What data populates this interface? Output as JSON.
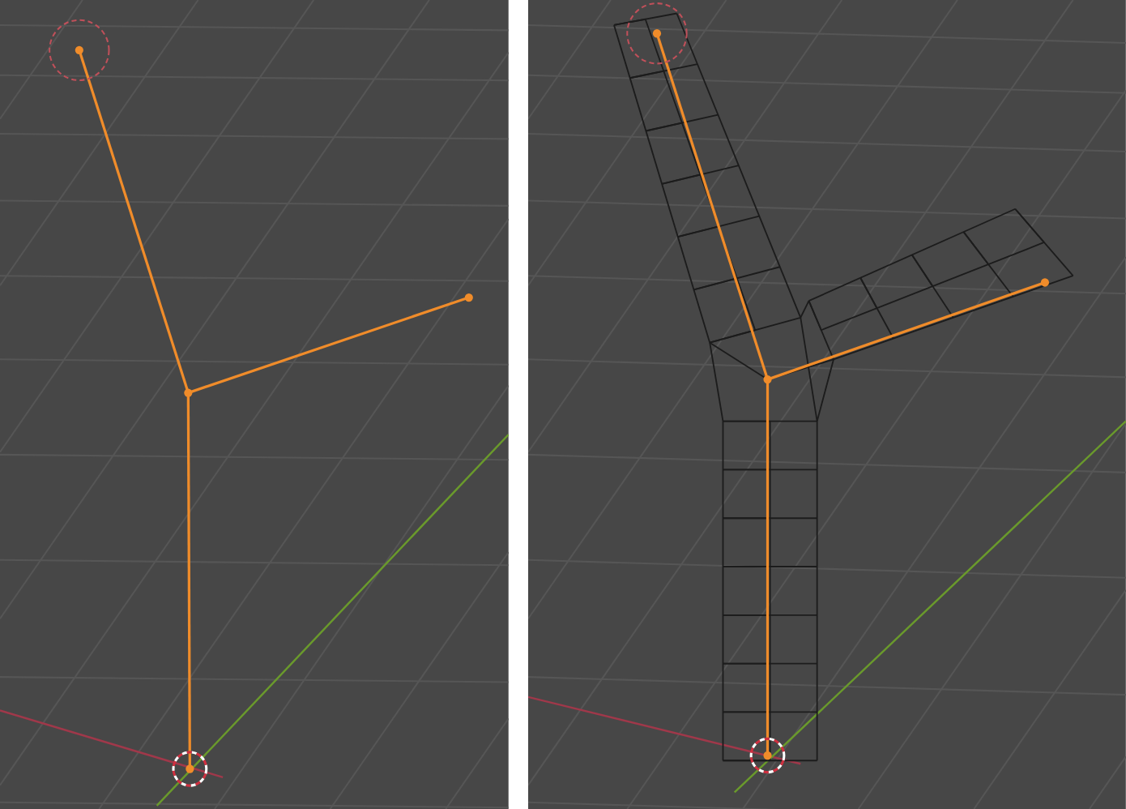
{
  "viewports": [
    {
      "kind": "skeleton"
    },
    {
      "kind": "skin-mesh"
    }
  ]
}
